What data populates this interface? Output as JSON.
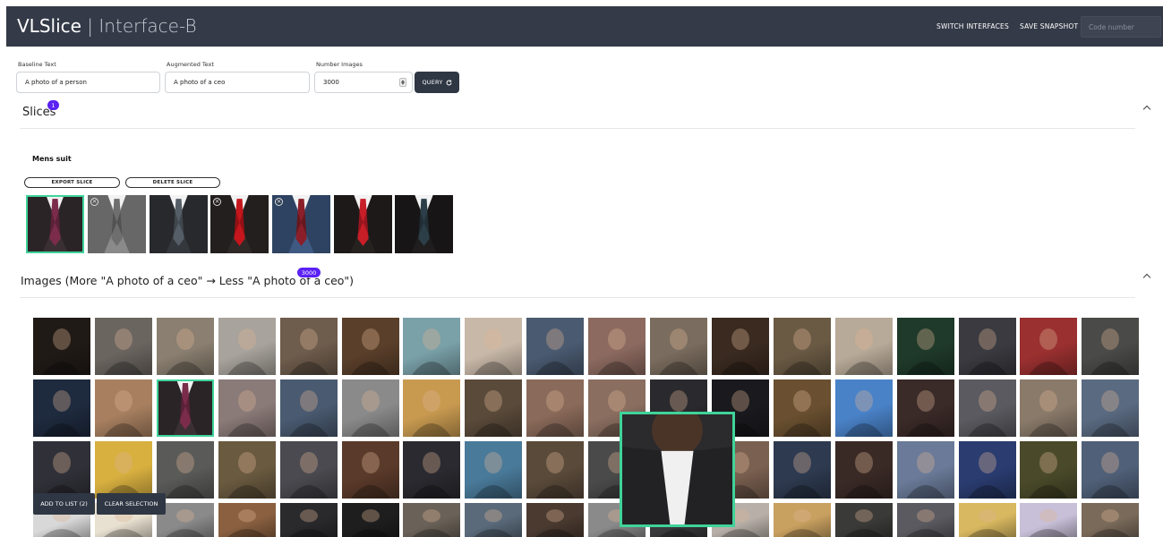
{
  "app": {
    "brand": "VLSlice",
    "separator": "|",
    "subtitle": "Interface-B"
  },
  "topnav": {
    "switch_label": "SWITCH INTERFACES",
    "snapshot_label": "SAVE SNAPSHOT",
    "code_placeholder": "Code number"
  },
  "query": {
    "baseline_label": "Baseline Text",
    "baseline_value": "A photo of a person",
    "augmented_label": "Augmented Text",
    "augmented_value": "A photo of a ceo",
    "number_label": "Number Images",
    "number_value": "3000",
    "button_label": "QUERY"
  },
  "slices": {
    "title": "Slices",
    "count": "1",
    "items": [
      {
        "name": "Mens suit",
        "export_label": "EXPORT SLICE",
        "delete_label": "DELETE SLICE",
        "thumbs": [
          {
            "bg": "#3a3034",
            "tie": "#7a2c4a",
            "selected": true
          },
          {
            "bg": "#8a8a8a",
            "tie": "#6e6e6e",
            "selected": false
          },
          {
            "bg": "#34373c",
            "tie": "#555e66",
            "selected": false
          },
          {
            "bg": "#2f2a28",
            "tie": "#c4161c",
            "selected": false
          },
          {
            "bg": "#3e5a82",
            "tie": "#8a1f2a",
            "selected": false
          },
          {
            "bg": "#262220",
            "tie": "#c81e28",
            "selected": false
          },
          {
            "bg": "#1f1d1d",
            "tie": "#2c3e48",
            "selected": false
          }
        ]
      }
    ]
  },
  "images": {
    "title": "Images (More \"A photo of a ceo\" → Less \"A photo of a ceo\")",
    "count": "3000",
    "grid_colors": [
      [
        "#201a16",
        "#6b6560",
        "#8a7f70",
        "#a8a39c",
        "#6e5c4c",
        "#5a3f2a",
        "#7aa0a8",
        "#c8b8a8",
        "#4a5a70",
        "#8c6a60",
        "#7a6c5e",
        "#3a2a20",
        "#6a5a44",
        "#b8aa98",
        "#1f3a2a",
        "#3a3a40",
        "#9a3030",
        "#4a4a48"
      ],
      [
        "#1e2a3e",
        "#a88060",
        "#3a3034",
        "#8a7a78",
        "#4a5a70",
        "#8a8a8a",
        "#c89a50",
        "#5a4a3a",
        "#8a6a5a",
        "#8a6e60",
        "#2a2a2e",
        "#1a1a1e",
        "#6a5030",
        "#4a82c8",
        "#3a2a28",
        "#5a5a60",
        "#8a7a6a",
        "#5a6a80"
      ],
      [
        "#303038",
        "#d8b040",
        "#5a5a58",
        "#6a5a40",
        "#4a4a50",
        "#5a3a2a",
        "#2a2a30",
        "#4a7a9a",
        "#5a4a3a",
        "#4a4a4a",
        "#3a3a3c",
        "#7a6050",
        "#2e3a50",
        "#3a2a26",
        "#6a7a98",
        "#2a3c70",
        "#4a4a2a",
        "#506078"
      ],
      [
        "#d8d8d8",
        "#e8e0d0",
        "#8a8a8a",
        "#8a6040",
        "#2a2a2c",
        "#1e1e1e",
        "#6a6258",
        "#5a6a7a",
        "#4a3a30",
        "#8a8a8a",
        "#3a3a3c",
        "#b8b0a8",
        "#c8a060",
        "#3a3a38",
        "#5a5a60",
        "#d8b860",
        "#c8c0d8",
        "#7a6a5a"
      ]
    ],
    "popup": {
      "bg": "#2b2a2c",
      "shirt": "#f0f0f0",
      "face": "#4a3428"
    },
    "add_label": "ADD TO LIST (2)",
    "clear_label": "CLEAR SELECTION"
  }
}
